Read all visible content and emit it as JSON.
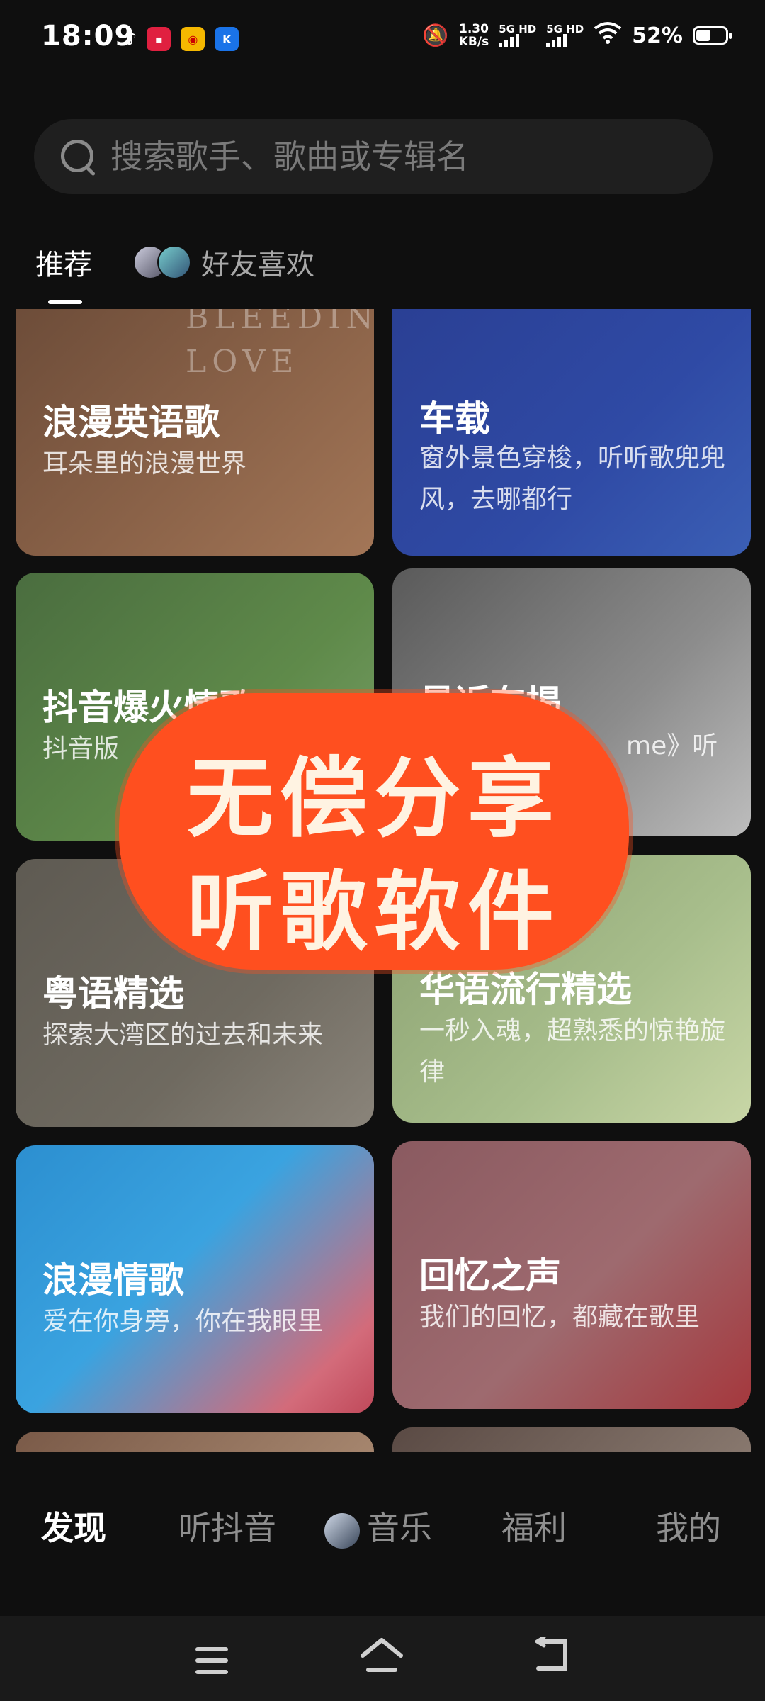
{
  "status_bar": {
    "time": "18:09",
    "speed_value": "1.30",
    "speed_unit": "KB/s",
    "sim1": "5G HD",
    "sim2": "5G HD",
    "battery_text": "52%",
    "battery_level": 0.52,
    "app_icons": [
      "small-app-icon",
      "red-app-icon",
      "weibo-icon",
      "blue-k-icon"
    ]
  },
  "search": {
    "placeholder": "搜索歌手、歌曲或专辑名"
  },
  "tabs": [
    {
      "label": "推荐",
      "active": true
    },
    {
      "label": "好友喜欢",
      "active": false
    }
  ],
  "cards": [
    {
      "title": "浪漫英语歌",
      "subtitle": "耳朵里的浪漫世界",
      "deco": "BLEEDIN LOVE"
    },
    {
      "title": "车载",
      "subtitle": "窗外景色穿梭，听听歌兜兜风，去哪都行"
    },
    {
      "title": "抖音爆火情歌",
      "subtitle": "抖音版"
    },
    {
      "title": "最近在揭",
      "subtitle": "me》听"
    },
    {
      "title": "粤语精选",
      "subtitle": "探索大湾区的过去和未来"
    },
    {
      "title": "华语流行精选",
      "subtitle": "一秒入魂，超熟悉的惊艳旋律"
    },
    {
      "title": "浪漫情歌",
      "subtitle": "爱在你身旁，你在我眼里"
    },
    {
      "title": "回忆之声",
      "subtitle": "我们的回忆，都藏在歌里"
    }
  ],
  "overlay": {
    "line1": "无偿分享",
    "line2": "听歌软件"
  },
  "bottom_nav": [
    {
      "label": "发现",
      "active": true
    },
    {
      "label": "听抖音",
      "active": false
    },
    {
      "label": "音乐",
      "active": false
    },
    {
      "label": "福利",
      "active": false
    },
    {
      "label": "我的",
      "active": false
    }
  ],
  "colors": {
    "background": "#0f0f0f",
    "accent_overlay": "#ff4f1f"
  }
}
